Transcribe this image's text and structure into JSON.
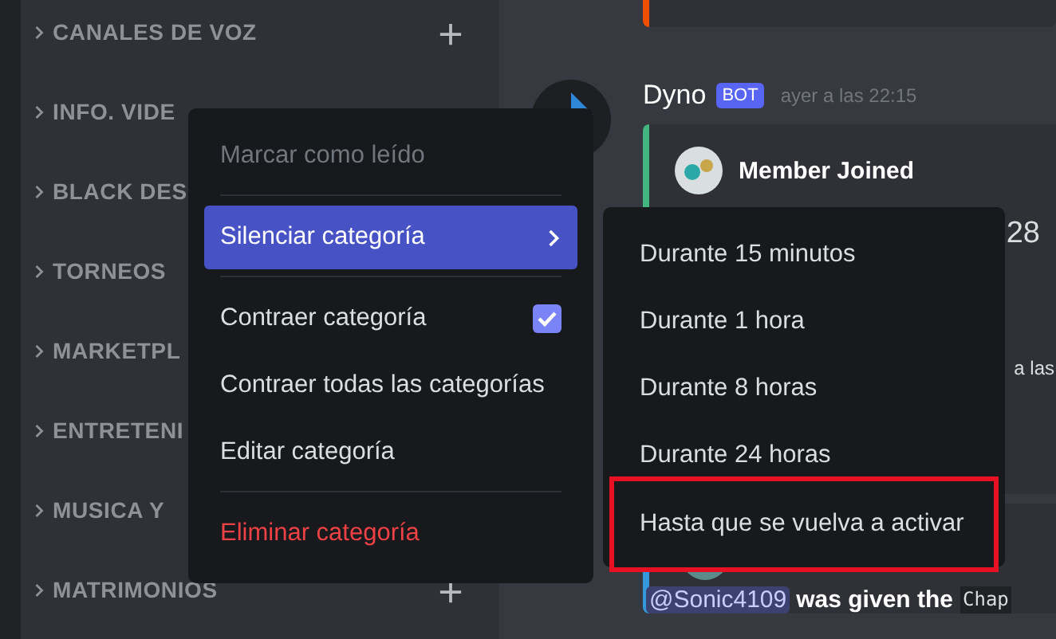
{
  "sidebar": {
    "categories": [
      {
        "name": "CANALES DE VOZ",
        "add_button": true
      },
      {
        "name": "INFO. VIDE",
        "add_button": false
      },
      {
        "name": "BLACK DES",
        "add_button": false
      },
      {
        "name": "TORNEOS",
        "add_button": false
      },
      {
        "name": "MARKETPL",
        "add_button": false
      },
      {
        "name": "ENTRETENI",
        "add_button": false
      },
      {
        "name": "MUSICA Y",
        "add_button": false
      },
      {
        "name": "MATRIMONIOS",
        "add_button": true
      }
    ]
  },
  "chat": {
    "message": {
      "author": "Dyno",
      "badge": "BOT",
      "timestamp": "ayer a las 22:15",
      "embed": {
        "title": "Member Joined",
        "line_1": "28",
        "line_2": "a las"
      },
      "embed_2": {
        "mention": "@Sonic4109",
        "text": "was given the",
        "code": "Chap"
      }
    }
  },
  "context_menu": {
    "items": [
      {
        "label": "Marcar como leído",
        "kind": "normal",
        "disabled": true,
        "selected": false,
        "separator_before": false
      },
      {
        "label": "Silenciar categoría",
        "kind": "submenu",
        "disabled": false,
        "selected": true,
        "separator_before": true
      },
      {
        "label": "Contraer categoría",
        "kind": "checkbox",
        "checked": true,
        "disabled": false,
        "selected": false,
        "separator_before": true
      },
      {
        "label": "Contraer todas las categorías",
        "kind": "normal",
        "disabled": false,
        "selected": false,
        "separator_before": false
      },
      {
        "label": "Editar categoría",
        "kind": "normal",
        "disabled": false,
        "selected": false,
        "separator_before": false
      },
      {
        "label": "Eliminar categoría",
        "kind": "danger",
        "disabled": false,
        "selected": false,
        "separator_before": true
      }
    ]
  },
  "submenu": {
    "items": [
      {
        "label": "Durante 15 minutos",
        "highlighted": false
      },
      {
        "label": "Durante 1 hora",
        "highlighted": false
      },
      {
        "label": "Durante 8 horas",
        "highlighted": false
      },
      {
        "label": "Durante 24 horas",
        "highlighted": false
      },
      {
        "label": "Hasta que se vuelva a activar",
        "highlighted": true
      }
    ]
  }
}
